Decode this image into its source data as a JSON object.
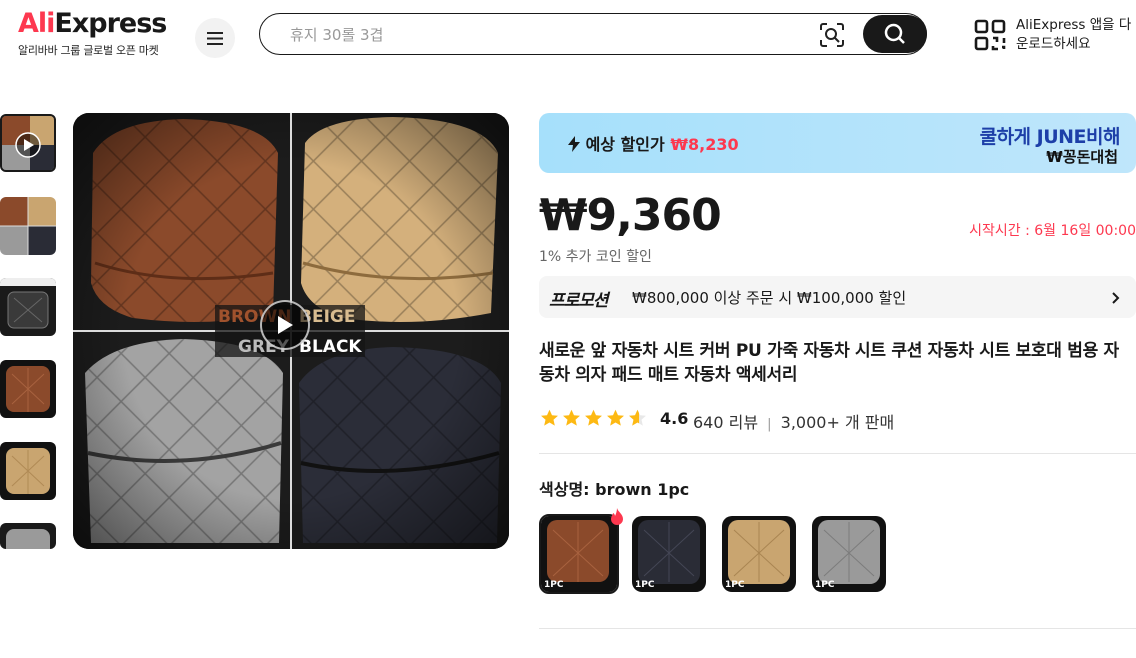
{
  "header": {
    "logo_text": "AliExpress",
    "logo_tagline": "알리바바 그룹 글로벌 오픈 마켓",
    "search_placeholder": "휴지 30롤 3겹",
    "app_promo_line1": "AliExpress 앱을 다",
    "app_promo_line2": "운로드하세요"
  },
  "gallery": {
    "image_labels": {
      "tl": "BROWN",
      "tr": "BEIGE",
      "bl": "GREY",
      "br": "BLACK"
    },
    "thumbnail_count": 6
  },
  "product": {
    "banner_left_label": "예상 할인가",
    "banner_left_value": "₩8,230",
    "banner_right_line1": "쿨하게 JUNE비해",
    "banner_right_line2": "₩꽁돈대첩",
    "price": "₩9,360",
    "sale_start": "시작시간 :  6월 16일 00:00",
    "coin_discount": "1% 추가 코인 할인",
    "promo_tag": "프로모션",
    "promo_text": "₩800,000 이상 주문 시 ₩100,000 할인",
    "title": "새로운 앞 자동차 시트 커버 PU 가죽 자동차 시트 쿠션 자동차 시트 보호대 범용 자동차 의자 패드 매트 자동차 액세서리",
    "rating": "4.6",
    "rating_stars": 4.6,
    "reviews": "640 리뷰",
    "sold": "3,000+ 개 판매",
    "color_label": "색상명: brown 1pc",
    "swatches": [
      {
        "name": "brown 1pc",
        "tag": "1PC",
        "color": "#8b4a2b"
      },
      {
        "name": "black 1pc",
        "tag": "1PC",
        "color": "#2a2c36"
      },
      {
        "name": "beige 1pc",
        "tag": "1PC",
        "color": "#c9a570"
      },
      {
        "name": "grey 1pc",
        "tag": "1PC",
        "color": "#9a9a9a"
      }
    ]
  },
  "colors": {
    "accent_red": "#fd384f",
    "banner_blue": "#1d3fa8",
    "star": "#fdb913"
  }
}
